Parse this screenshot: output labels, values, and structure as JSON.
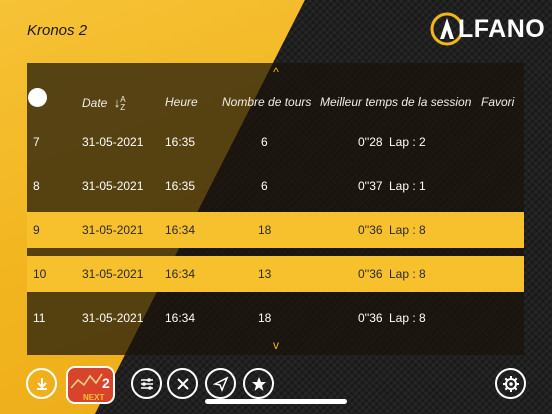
{
  "header": {
    "title": "Kronos 2",
    "logo_text": "LFANO"
  },
  "scroll": {
    "up": "^",
    "down": "v"
  },
  "columns": {
    "date": "Date",
    "sort_letters": "A\nZ",
    "time": "Heure",
    "laps": "Nombre de tours",
    "best": "Meilleur temps de la session",
    "favorite": "Favori"
  },
  "rows": [
    {
      "num": "7",
      "date": "31-05-2021",
      "time": "16:35",
      "laps": "6",
      "best": "0''28",
      "lap": "Lap : 2",
      "selected": false
    },
    {
      "num": "8",
      "date": "31-05-2021",
      "time": "16:35",
      "laps": "6",
      "best": "0''37",
      "lap": "Lap : 1",
      "selected": false
    },
    {
      "num": "9",
      "date": "31-05-2021",
      "time": "16:34",
      "laps": "18",
      "best": "0''36",
      "lap": "Lap : 8",
      "selected": true
    },
    {
      "num": "10",
      "date": "31-05-2021",
      "time": "16:34",
      "laps": "13",
      "best": "0''36",
      "lap": "Lap : 8",
      "selected": true
    },
    {
      "num": "11",
      "date": "31-05-2021",
      "time": "16:34",
      "laps": "18",
      "best": "0''36",
      "lap": "Lap : 8",
      "selected": false
    }
  ],
  "footer": {
    "next_label": "NEXT"
  },
  "colors": {
    "accent": "#f7c12e",
    "next_button": "#d7442b"
  }
}
